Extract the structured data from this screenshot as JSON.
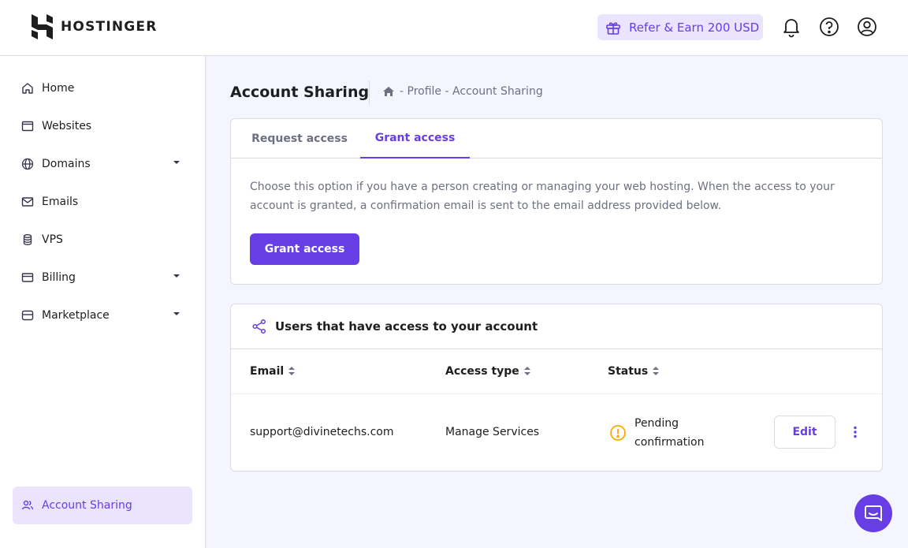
{
  "brand": {
    "name": "HOSTINGER"
  },
  "header": {
    "refer_label": "Refer & Earn 200 USD",
    "icons": [
      "bell-icon",
      "help-icon",
      "user-icon"
    ]
  },
  "sidebar": {
    "items": [
      {
        "label": "Home",
        "icon": "home-icon",
        "has_dropdown": false
      },
      {
        "label": "Websites",
        "icon": "browser-icon",
        "has_dropdown": false
      },
      {
        "label": "Domains",
        "icon": "globe-icon",
        "has_dropdown": true
      },
      {
        "label": "Emails",
        "icon": "mail-icon",
        "has_dropdown": false
      },
      {
        "label": "VPS",
        "icon": "server-icon",
        "has_dropdown": false
      },
      {
        "label": "Billing",
        "icon": "card-icon",
        "has_dropdown": true
      },
      {
        "label": "Marketplace",
        "icon": "store-icon",
        "has_dropdown": true
      }
    ],
    "active_item": {
      "label": "Account Sharing",
      "icon": "users-icon"
    }
  },
  "page": {
    "title": "Account Sharing",
    "breadcrumb": [
      "- Profile - Account Sharing"
    ]
  },
  "access_card": {
    "tabs": [
      {
        "label": "Request access",
        "active": false
      },
      {
        "label": "Grant access",
        "active": true
      }
    ],
    "description": "Choose this option if you have a person creating or managing your web hosting. When the access to your account is granted, a confirmation email is sent to the email address provided below.",
    "button_label": "Grant access"
  },
  "users_card": {
    "title": "Users that have access to your account",
    "columns": [
      "Email",
      "Access type",
      "Status"
    ],
    "rows": [
      {
        "email": "support@divinetechs.com",
        "access_type": "Manage Services",
        "status_line1": "Pending",
        "status_line2": "confirmation",
        "action_label": "Edit"
      }
    ]
  },
  "colors": {
    "accent": "#673de6",
    "accent_light": "#ebe4ff",
    "warning": "#ffa800",
    "background": "#f4f5ff"
  }
}
